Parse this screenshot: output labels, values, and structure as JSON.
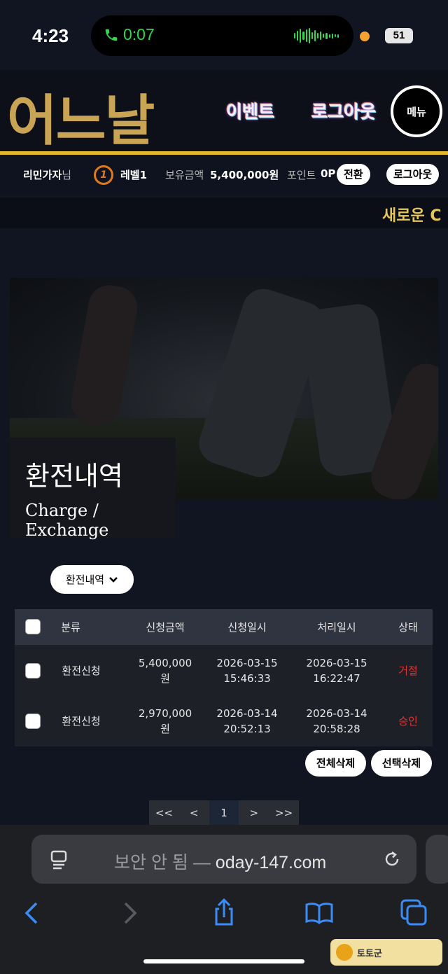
{
  "status": {
    "time": "4:23",
    "call_timer": "0:07",
    "battery": "51"
  },
  "header": {
    "logo": "어느날",
    "nav": [
      "이벤트",
      "로그아웃"
    ],
    "menu_label": "메뉴"
  },
  "user": {
    "name": "리민가자",
    "name_suffix": "님",
    "level_icon": "1",
    "level": "레벨1",
    "balance_label": "보유금액",
    "balance": "5,400,000원",
    "points_label": "포인트",
    "points": "0P",
    "convert_label": "전환",
    "logout_label": "로그아웃"
  },
  "marquee": "새로운 C",
  "hero": {
    "title": "환전내역",
    "subtitle": "Charge / Exchange"
  },
  "filter": {
    "selected": "환전내역"
  },
  "table": {
    "headers": [
      "분류",
      "신청금액",
      "신청일시",
      "처리일시",
      "상태"
    ],
    "rows": [
      {
        "type": "환전신청",
        "amount": "5,400,000",
        "unit": "원",
        "req_date": "2026-03-15",
        "req_time": "15:46:33",
        "proc_date": "2026-03-15",
        "proc_time": "16:22:47",
        "status": "거절"
      },
      {
        "type": "환전신청",
        "amount": "2,970,000",
        "unit": "원",
        "req_date": "2026-03-14",
        "req_time": "20:52:13",
        "proc_date": "2026-03-14",
        "proc_time": "20:58:28",
        "status": "승인"
      }
    ],
    "status_color": "#e03232"
  },
  "actions": {
    "delete_all": "전체삭제",
    "delete_selected": "선택삭제"
  },
  "pagination": {
    "first": "<<",
    "prev": "<",
    "current": "1",
    "next": ">",
    "last": ">>"
  },
  "browser": {
    "security": "보안 안 됨 —",
    "domain": "oday-147.com"
  },
  "icons": [
    "phone-icon",
    "reader-icon",
    "reload-icon",
    "back-icon",
    "forward-icon",
    "share-icon",
    "bookmarks-icon",
    "tabs-icon",
    "chevron-down-icon",
    "level-badge-icon"
  ],
  "watermark": "토토군"
}
